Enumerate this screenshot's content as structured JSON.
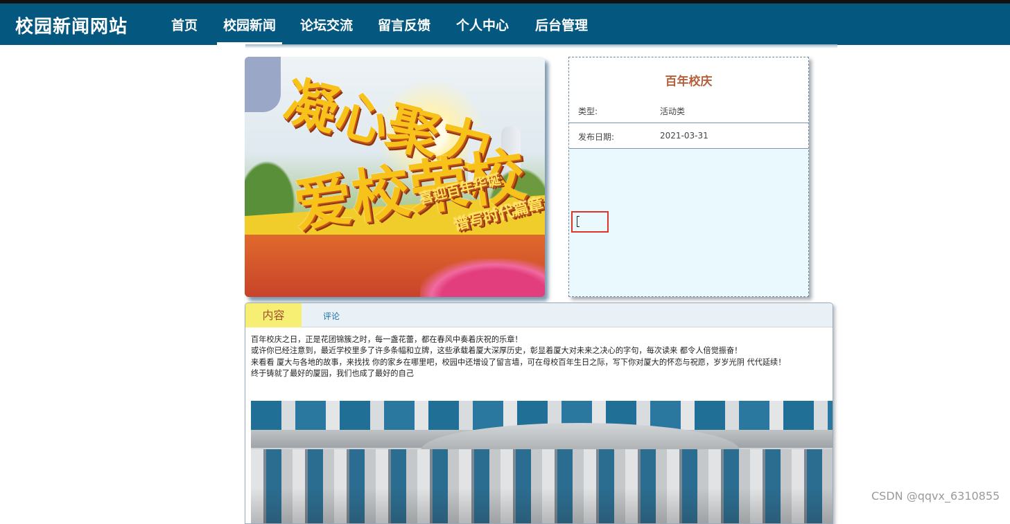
{
  "navbar": {
    "brand": "校园新闻网站",
    "items": [
      {
        "label": "首页"
      },
      {
        "label": "校园新闻",
        "active": true
      },
      {
        "label": "论坛交流"
      },
      {
        "label": "留言反馈"
      },
      {
        "label": "个人中心"
      },
      {
        "label": "后台管理"
      }
    ]
  },
  "hero": {
    "line1": "凝心聚力",
    "line2": "爱校荣校",
    "line3": "喜迎百年华诞",
    "line4": "谱写时代篇章"
  },
  "info": {
    "title": "百年校庆",
    "type_label": "类型:",
    "type_value": "活动类",
    "date_label": "发布日期:",
    "date_value": "2021-03-31"
  },
  "tabs": {
    "content": "内容",
    "comments": "评论"
  },
  "article": {
    "paragraphs": [
      "百年校庆之日，正是花团锦簇之时，每一盏花蕾，都在春风中奏着庆祝的乐章！",
      "或许你已经注意到，最近学校里多了许多条幅和立牌，这些承载着厦大深厚历史，彰显着厦大对未来之决心的字句，每次读来 都令人倍觉振奋！",
      "来看看 厦大与各地的故事，来找找 你的家乡在哪里吧，校园中还增设了留言墙，可在母校百年生日之际，写下你对厦大的怀恋与祝愿，岁岁光阴 代代延续！",
      "终于铸就了最好的厦园，我们也成了最好的自己"
    ]
  },
  "watermark": "CSDN @qqvx_6310855",
  "colors": {
    "navbar": "#04577f",
    "title_accent": "#b45f3a",
    "info_body": "#eaf9fe",
    "tab_active": "#f7ee74",
    "highlight_box": "#e0342b"
  }
}
